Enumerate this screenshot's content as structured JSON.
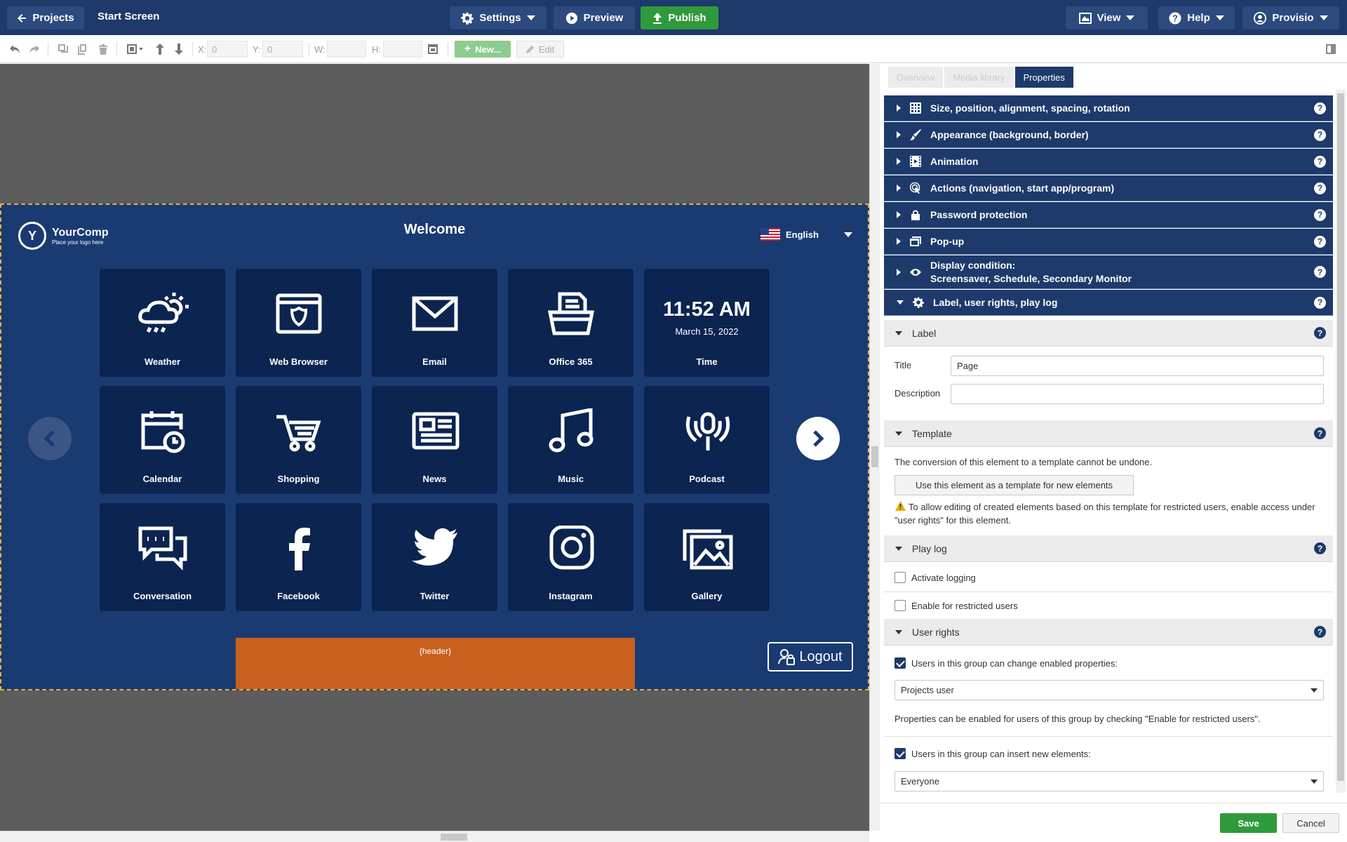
{
  "topbar": {
    "projects_label": "Projects",
    "screen_name": "Start Screen",
    "settings_label": "Settings",
    "preview_label": "Preview",
    "publish_label": "Publish",
    "view_label": "View",
    "help_label": "Help",
    "user_label": "Provisio"
  },
  "toolbar": {
    "x_label": "X:",
    "x_value": "0",
    "y_label": "Y:",
    "y_value": "0",
    "w_label": "W:",
    "w_value": "",
    "h_label": "H:",
    "h_value": "",
    "new_label": "New...",
    "edit_label": "Edit"
  },
  "page": {
    "logo_letter": "Y",
    "logo_name": "YourComp",
    "logo_sub": "Place your logo here",
    "welcome": "Welcome",
    "language": "English",
    "time": "11:52 AM",
    "date": "March 15, 2022",
    "header_placeholder": "{header}",
    "logout_label": "Logout",
    "tiles": [
      {
        "label": "Weather",
        "icon": "weather-icon"
      },
      {
        "label": "Web Browser",
        "icon": "web-browser-icon"
      },
      {
        "label": "Email",
        "icon": "email-icon"
      },
      {
        "label": "Office 365",
        "icon": "office-icon"
      },
      {
        "label": "Time",
        "icon": "clock"
      },
      {
        "label": "Calendar",
        "icon": "calendar-icon"
      },
      {
        "label": "Shopping",
        "icon": "shopping-cart-icon"
      },
      {
        "label": "News",
        "icon": "newspaper-icon"
      },
      {
        "label": "Music",
        "icon": "music-note-icon"
      },
      {
        "label": "Podcast",
        "icon": "podcast-icon"
      },
      {
        "label": "Conversation",
        "icon": "chat-icon"
      },
      {
        "label": "Facebook",
        "icon": "facebook-icon"
      },
      {
        "label": "Twitter",
        "icon": "twitter-icon"
      },
      {
        "label": "Instagram",
        "icon": "instagram-icon"
      },
      {
        "label": "Gallery",
        "icon": "gallery-icon"
      }
    ]
  },
  "panel": {
    "tabs": [
      "Overview",
      "Media library",
      "Properties"
    ],
    "sections": [
      "Size, position, alignment, spacing, rotation",
      "Appearance (background, border)",
      "Animation",
      "Actions (navigation, start app/program)",
      "Password protection",
      "Pop-up",
      "Display condition:",
      "Screensaver, Schedule, Secondary Monitor",
      "Label, user rights, play log"
    ],
    "label_section": "Label",
    "title_label": "Title",
    "title_value": "Page",
    "description_label": "Description",
    "description_value": "",
    "template_section": "Template",
    "template_note": "The conversion of this element to a template cannot be undone.",
    "template_button": "Use this element as a template for new elements",
    "template_warning": "To allow editing of created elements based on this template for restricted users, enable access under \"user rights\" for this element.",
    "playlog_section": "Play log",
    "activate_logging": "Activate logging",
    "enable_restricted": "Enable for restricted users",
    "userrights_section": "User rights",
    "change_props_label": "Users in this group can change enabled properties:",
    "change_props_group": "Projects user",
    "props_note": "Properties can be enabled for users of this group by checking \"Enable for restricted users\".",
    "insert_label": "Users in this group can insert new elements:",
    "insert_group": "Everyone",
    "save_label": "Save",
    "cancel_label": "Cancel"
  },
  "colors": {
    "topbar": "#1d3a6b",
    "publish": "#2f9a3c",
    "page_bg": "#1a3a72",
    "tile_bg": "#0b2450",
    "header_box": "#c8601e"
  }
}
